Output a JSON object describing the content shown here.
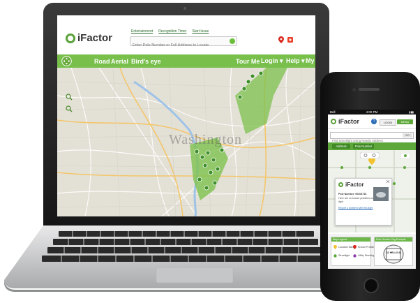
{
  "laptop": {
    "brand": "iFactor",
    "top_links": [
      "Entertainment",
      "Recognition Timer",
      "Start Issue"
    ],
    "search_placeholder": "Enter Pole Number or Full Address to Locate",
    "nav_left": [
      "Road",
      "Aerial",
      "Bird's eye"
    ],
    "nav_right": [
      "Tour Me",
      "Login ▾",
      "Help ▾",
      "My Reports ▾"
    ],
    "map_label": "Washington",
    "colors": {
      "accent": "#78bf4c",
      "brand_green": "#5aa13a",
      "pin_red": "#d9261c"
    }
  },
  "phone": {
    "status_time": "4:00 PM",
    "status_carrier": "Bell",
    "brand": "iFactor",
    "help_icon": "?",
    "login_label": "LOGIN",
    "menu_label": "MENU",
    "search_placeholder": "Find Streetlight Using Nearby Address",
    "go_label": "GO",
    "tab_address": "Address",
    "tab_pole": "Pole Number",
    "popup": {
      "brand": "iFactor",
      "pole_label": "Pole Number: 00204716",
      "line1": "Here are no known problems with this",
      "line2": "light.",
      "link": "Report a problem with this light"
    },
    "legend_title": "Map Legend",
    "legend_items": [
      "Location Marker",
      "Known Problem",
      "Streetlight",
      "Utility Streetlight"
    ],
    "tag_title": "Pole Number Tag Example",
    "tag_text": "12 HELLO 34"
  }
}
